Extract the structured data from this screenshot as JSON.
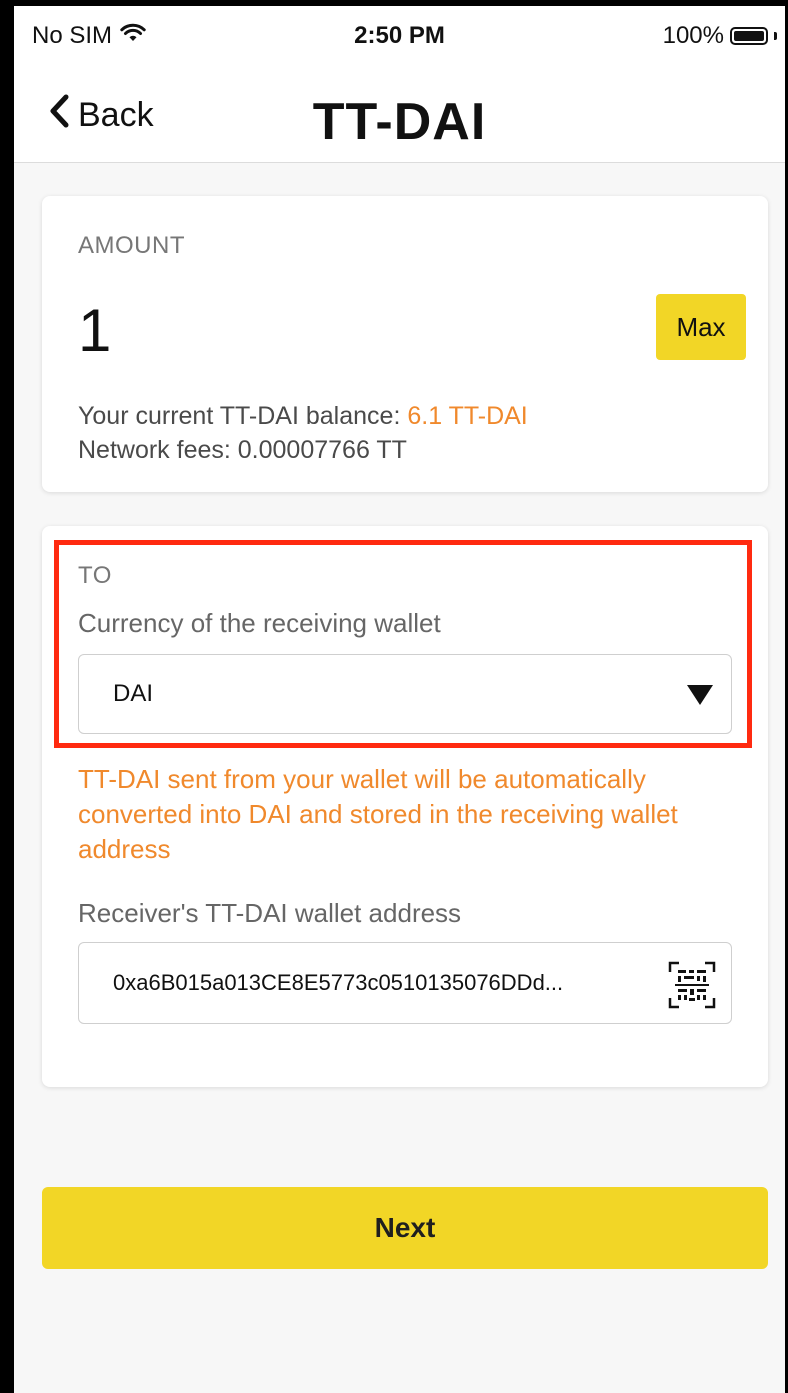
{
  "status_bar": {
    "carrier": "No SIM",
    "time": "2:50 PM",
    "battery": "100%",
    "battery_level": 1.0,
    "icons": [
      "wifi-icon",
      "battery-icon"
    ]
  },
  "nav": {
    "back_label": "Back",
    "title": "TT-DAI",
    "back_icon": "chevron-left-icon"
  },
  "amount_card": {
    "label": "AMOUNT",
    "value": "1",
    "max_label": "Max",
    "balance_prefix": "Your current TT-DAI balance: ",
    "balance_value": "6.1 TT-DAI",
    "fees": "Network fees: 0.00007766 TT"
  },
  "to_card": {
    "label": "TO",
    "currency_label": "Currency of the receiving wallet",
    "currency_selected": "DAI",
    "conversion_note": "TT-DAI sent from your wallet will be automatically converted into DAI and stored in the receiving wallet address",
    "address_label": "Receiver's TT-DAI wallet address",
    "address_value": "0xa6B015a013CE8E5773c0510135076DDd...",
    "qr_icon": "qr-scan-icon"
  },
  "footer": {
    "next_label": "Next"
  },
  "colors": {
    "accent_yellow": "#f2d626",
    "warning_orange": "#f0892c",
    "highlight_red": "#ff2a10"
  }
}
